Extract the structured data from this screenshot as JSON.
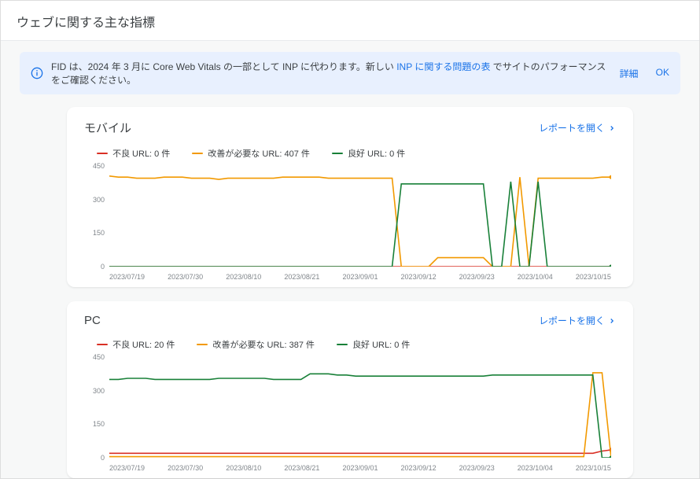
{
  "page_title": "ウェブに関する主な指標",
  "banner": {
    "prefix": "FID は、2024 年 3 月に Core Web Vitals の一部として INP に代わります。新しい ",
    "link": "INP に関する問題の表",
    "suffix": " でサイトのパフォーマンスをご確認ください。",
    "detail": "詳細",
    "ok": "OK"
  },
  "open_report_label": "レポートを開く",
  "cards": {
    "mobile": {
      "title": "モバイル",
      "legend": {
        "bad": "不良 URL: 0 件",
        "improve": "改善が必要な URL: 407 件",
        "good": "良好 URL: 0 件"
      }
    },
    "pc": {
      "title": "PC",
      "legend": {
        "bad": "不良 URL: 20 件",
        "improve": "改善が必要な URL: 387 件",
        "good": "良好 URL: 0 件"
      }
    }
  },
  "axis": {
    "y": [
      "450",
      "300",
      "150",
      "0"
    ],
    "x": [
      "2023/07/19",
      "2023/07/30",
      "2023/08/10",
      "2023/08/21",
      "2023/09/01",
      "2023/09/12",
      "2023/09/23",
      "2023/10/04",
      "2023/10/15"
    ]
  },
  "chart_data": [
    {
      "id": "mobile",
      "type": "line",
      "title": "モバイル",
      "xlabel": "",
      "ylabel": "",
      "ylim": [
        0,
        450
      ],
      "x": [
        "2023/07/19",
        "2023/07/30",
        "2023/08/10",
        "2023/08/21",
        "2023/09/01",
        "2023/09/12",
        "2023/09/23",
        "2023/10/04",
        "2023/10/15"
      ],
      "series": [
        {
          "name": "不良 URL",
          "color": "#d93025",
          "values": [
            0,
            0,
            0,
            0,
            0,
            0,
            0,
            0,
            0
          ]
        },
        {
          "name": "改善が必要な URL",
          "color": "#f29900",
          "values": [
            405,
            400,
            400,
            395,
            395,
            395,
            400,
            400,
            400,
            395,
            395,
            395,
            390,
            395,
            395,
            395,
            395,
            395,
            395,
            400,
            400,
            400,
            400,
            400,
            395,
            395,
            395,
            395,
            395,
            395,
            395,
            395,
            0,
            0,
            0,
            0,
            40,
            40,
            40,
            40,
            40,
            40,
            0,
            0,
            0,
            400,
            0,
            395,
            395,
            395,
            395,
            395,
            395,
            395,
            400,
            400
          ]
        },
        {
          "name": "良好 URL",
          "color": "#188038",
          "values": [
            0,
            0,
            0,
            0,
            0,
            0,
            0,
            0,
            0,
            0,
            0,
            0,
            0,
            0,
            0,
            0,
            0,
            0,
            0,
            0,
            0,
            0,
            0,
            0,
            0,
            0,
            0,
            0,
            0,
            0,
            0,
            0,
            370,
            370,
            370,
            370,
            370,
            370,
            370,
            370,
            370,
            370,
            0,
            0,
            380,
            0,
            0,
            380,
            0,
            0,
            0,
            0,
            0,
            0,
            0,
            0
          ]
        }
      ]
    },
    {
      "id": "pc",
      "type": "line",
      "title": "PC",
      "xlabel": "",
      "ylabel": "",
      "ylim": [
        0,
        450
      ],
      "x": [
        "2023/07/19",
        "2023/07/30",
        "2023/08/10",
        "2023/08/21",
        "2023/09/01",
        "2023/09/12",
        "2023/09/23",
        "2023/10/04",
        "2023/10/15"
      ],
      "series": [
        {
          "name": "不良 URL",
          "color": "#d93025",
          "values": [
            20,
            20,
            20,
            20,
            20,
            20,
            20,
            20,
            20,
            20,
            20,
            20,
            20,
            20,
            20,
            20,
            20,
            20,
            20,
            20,
            20,
            20,
            20,
            20,
            20,
            20,
            20,
            20,
            20,
            20,
            20,
            20,
            20,
            20,
            20,
            20,
            20,
            20,
            20,
            20,
            20,
            20,
            20,
            20,
            20,
            20,
            20,
            20,
            20,
            20,
            20,
            20,
            20,
            20,
            30,
            35
          ]
        },
        {
          "name": "改善が必要な URL",
          "color": "#f29900",
          "values": [
            5,
            5,
            5,
            5,
            5,
            5,
            5,
            5,
            5,
            5,
            5,
            5,
            5,
            5,
            5,
            5,
            5,
            5,
            5,
            5,
            5,
            5,
            5,
            5,
            5,
            5,
            5,
            5,
            5,
            5,
            5,
            5,
            5,
            5,
            5,
            5,
            5,
            5,
            5,
            5,
            5,
            5,
            5,
            5,
            5,
            5,
            5,
            5,
            5,
            5,
            5,
            5,
            5,
            380,
            380,
            0
          ]
        },
        {
          "name": "良好 URL",
          "color": "#188038",
          "values": [
            350,
            350,
            355,
            355,
            355,
            350,
            350,
            350,
            350,
            350,
            350,
            350,
            355,
            355,
            355,
            355,
            355,
            355,
            350,
            350,
            350,
            350,
            375,
            375,
            375,
            370,
            370,
            365,
            365,
            365,
            365,
            365,
            365,
            365,
            365,
            365,
            365,
            365,
            365,
            365,
            365,
            365,
            370,
            370,
            370,
            370,
            370,
            370,
            370,
            370,
            370,
            370,
            370,
            370,
            0,
            0
          ]
        }
      ]
    }
  ]
}
